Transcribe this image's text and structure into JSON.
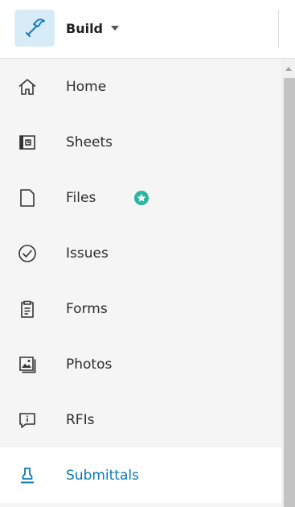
{
  "product": {
    "name": "Build",
    "logo_icon": "hammer-icon",
    "accent_color": "#d8ecf7"
  },
  "nav": {
    "active_color": "#0a7ab8",
    "items": [
      {
        "label": "Home",
        "icon": "home-icon"
      },
      {
        "label": "Sheets",
        "icon": "sheets-icon"
      },
      {
        "label": "Files",
        "icon": "file-icon",
        "badge": "star-badge-icon",
        "badge_color": "#2bb5a0"
      },
      {
        "label": "Issues",
        "icon": "check-circle-icon"
      },
      {
        "label": "Forms",
        "icon": "clipboard-icon"
      },
      {
        "label": "Photos",
        "icon": "photos-icon"
      },
      {
        "label": "RFIs",
        "icon": "rfi-icon"
      },
      {
        "label": "Submittals",
        "icon": "stamp-icon",
        "active": true
      }
    ]
  }
}
